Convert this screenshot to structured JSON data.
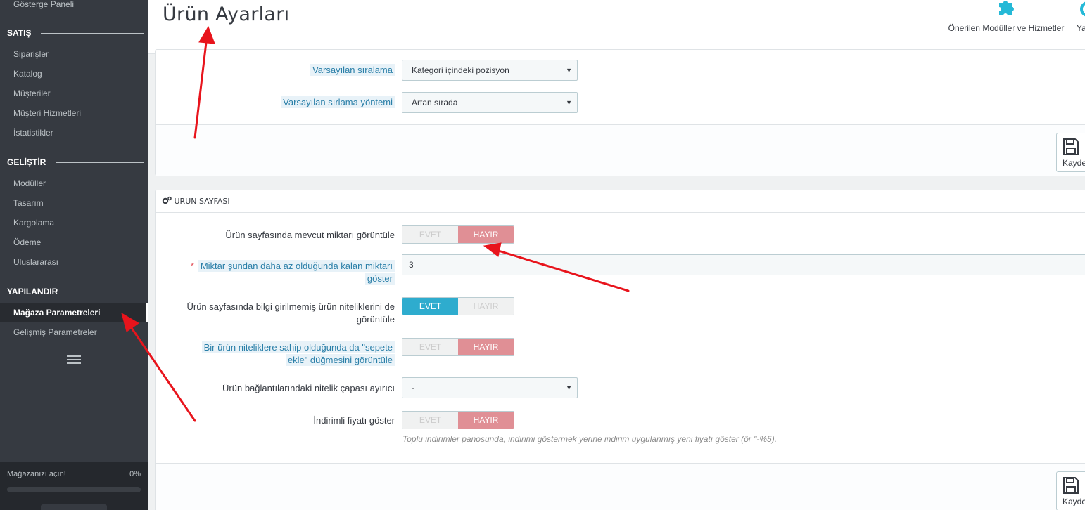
{
  "sidebar": {
    "top_item": "Gösterge Paneli",
    "sections": [
      {
        "title": "SATIŞ",
        "items": [
          "Siparişler",
          "Katalog",
          "Müşteriler",
          "Müşteri Hizmetleri",
          "İstatistikler"
        ]
      },
      {
        "title": "GELİŞTİR",
        "items": [
          "Modüller",
          "Tasarım",
          "Kargolama",
          "Ödeme",
          "Uluslararası"
        ]
      },
      {
        "title": "YAPILANDIR",
        "items": [
          "Mağaza Parametreleri",
          "Gelişmiş Parametreler"
        ]
      }
    ],
    "active_item": "Mağaza Parametreleri",
    "shop_progress": {
      "label": "Mağazanızı açın!",
      "percent_text": "0%",
      "value": 0
    }
  },
  "header": {
    "title": "Ürün Ayarları",
    "toolbar": {
      "modules_label": "Önerilen Modüller ve Hizmetler",
      "help_label": "Ya"
    }
  },
  "pagination_panel": {
    "rows": [
      {
        "label": "Varsayılan sıralama",
        "value": "Kategori içindeki pozisyon"
      },
      {
        "label": "Varsayılan sırlama yöntemi",
        "value": "Artan sırada"
      }
    ],
    "save_label": "Kayde"
  },
  "product_page_panel": {
    "heading": "ÜRÜN SAYFASI",
    "rows": [
      {
        "label": "Ürün sayfasında mevcut miktarı görüntüle",
        "yes": "EVET",
        "no": "HAYIR",
        "selected": "no"
      },
      {
        "label_line1": "Miktar şundan daha az olduğunda kalan miktarı",
        "label_line2": "göster",
        "required": "*",
        "value": "3"
      },
      {
        "label_line1": "Ürün sayfasında bilgi girilmemiş ürün niteliklerini de",
        "label_line2": "görüntüle",
        "yes": "EVET",
        "no": "HAYIR",
        "selected": "yes"
      },
      {
        "label_line1": "Bir ürün niteliklere sahip olduğunda da \"sepete",
        "label_line2": "ekle\" düğmesini görüntüle",
        "yes": "EVET",
        "no": "HAYIR",
        "selected": "no"
      },
      {
        "label": "Ürün bağlantılarındaki nitelik çapası ayırıcı",
        "value": "-"
      },
      {
        "label": "İndirimli fiyatı göster",
        "yes": "EVET",
        "no": "HAYIR",
        "selected": "no",
        "help": "Toplu indirimler panosunda, indirimi göstermek yerine indirim uygulanmış yeni fiyatı göster (ör \"-%5)."
      }
    ],
    "save_label": "Kayde"
  },
  "colors": {
    "sidebar_bg": "#363a41",
    "accent": "#25b9d7",
    "toggle_yes": "#2eacce",
    "toggle_no": "#e08f95",
    "annotation_arrow": "#e8141c"
  },
  "icons": [
    "puzzle-icon",
    "save-icon",
    "gears-icon",
    "hamburger-icon",
    "caret-down-icon"
  ]
}
